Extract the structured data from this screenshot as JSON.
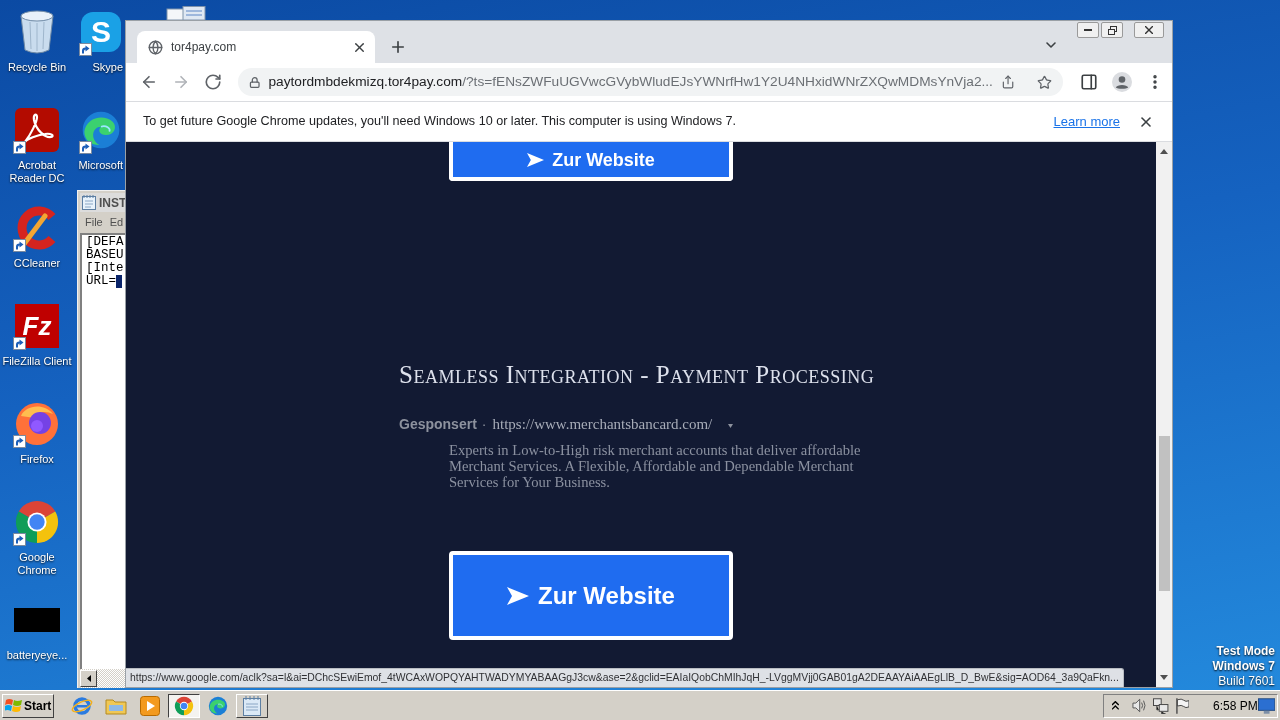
{
  "desktop": {
    "icons_column_1": [
      {
        "kind": "recycle_bin",
        "label": "Recycle Bin",
        "shortcut": false
      },
      {
        "kind": "acrobat",
        "label": "Acrobat Reader DC",
        "shortcut": true
      },
      {
        "kind": "ccleaner",
        "label": "CCleaner",
        "shortcut": true
      },
      {
        "kind": "filezilla",
        "label": "FileZilla Client",
        "shortcut": true,
        "logo_text": "Fz"
      },
      {
        "kind": "firefox",
        "label": "Firefox",
        "shortcut": true
      },
      {
        "kind": "chrome",
        "label": "Google Chrome",
        "shortcut": true
      },
      {
        "kind": "blank",
        "label": "batteryeye...",
        "shortcut": false
      }
    ],
    "icons_column_2": [
      {
        "kind": "skype",
        "label": "Skype",
        "shortcut": true,
        "logo_text": "S"
      },
      {
        "kind": "edge",
        "label": "Microsoft",
        "shortcut": true
      }
    ],
    "test_mode_notice": [
      {
        "text": "Test Mode",
        "bold": true
      },
      {
        "text": "Windows 7",
        "bold": true
      },
      {
        "text": "Build 7601",
        "bold": false
      }
    ]
  },
  "notepad": {
    "title": "INST",
    "menu": [
      "File",
      "Ed"
    ],
    "lines": [
      {
        "text": "[DEFA",
        "selection": false
      },
      {
        "text": "BASEU",
        "selection": false
      },
      {
        "text": "[Inte",
        "selection": false
      },
      {
        "text": "URL=",
        "selection": true
      }
    ]
  },
  "browser": {
    "tabs": [
      {
        "title": "tor4pay.com",
        "selected": true
      }
    ],
    "nav_buttons": [
      {
        "kind": "back",
        "disabled": false
      },
      {
        "kind": "forward",
        "disabled": true
      },
      {
        "kind": "reload",
        "disabled": false
      }
    ],
    "address": {
      "host": "paytordmbdekmizq.tor4pay.com",
      "path": "/?ts=fENsZWFuUGVwcGVybWludEJsYWNrfHw1Y2U4NHxidWNrZXQwMDMsYnVja2..."
    },
    "infobar": {
      "message": "To get future Google Chrome updates, you'll need Windows 10 or later. This computer is using Windows 7.",
      "link": "Learn more"
    },
    "page": {
      "top_button": {
        "label": "Zur Website"
      },
      "ad": {
        "title": "Seamless Integration - Payment Processing",
        "sponsored": "Gesponsert",
        "separator": "·",
        "url": "https://www.merchantsbancard.com/",
        "description": "Experts in Low-to-High risk merchant accounts that deliver affordable Merchant Services. A Flexible, Affordable and Dependable Merchant Services for Your Business."
      },
      "bottom_button": {
        "label": "Zur Website"
      }
    },
    "status_url": "https://www.google.com/aclk?sa=l&ai=DChcSEwiEmof_4tWCAxWOPQYAHTWADYMYABAAGgJ3cw&ase=2&gclid=EAIaIQobChMIhJqH_-LVggMVjj0GAB01gA2DEAAYAiAAEgLlB_D_BwE&sig=AOD64_3a9QaFkn..."
  },
  "taskbar": {
    "start": "Start",
    "items": [
      {
        "kind": "ie",
        "window": false,
        "selected": false
      },
      {
        "kind": "folder",
        "window": false,
        "selected": false
      },
      {
        "kind": "media_player",
        "window": false,
        "selected": false
      },
      {
        "kind": "chrome",
        "window": true,
        "selected": true
      },
      {
        "kind": "edge",
        "window": false,
        "selected": false
      },
      {
        "kind": "notepad",
        "window": true,
        "selected": false
      }
    ],
    "clock": "6:58 PM"
  }
}
